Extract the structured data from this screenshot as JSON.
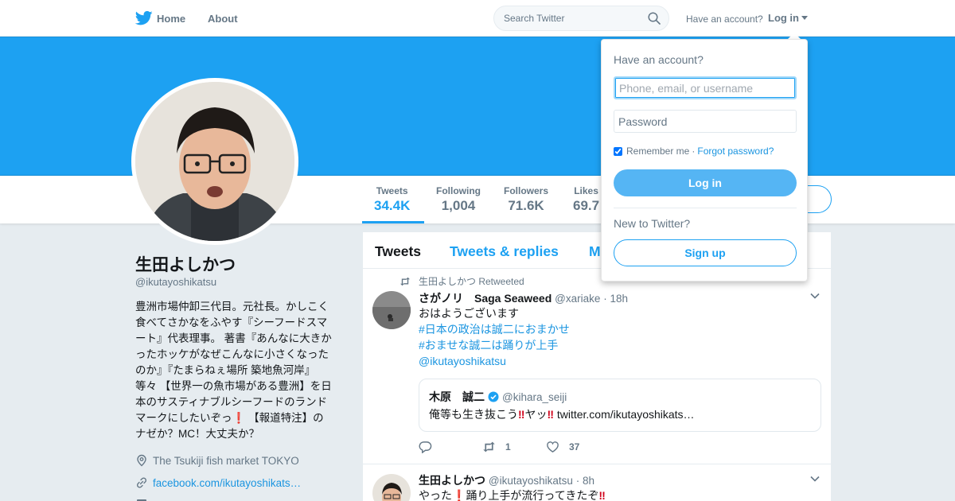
{
  "nav": {
    "home_label": "Home",
    "about_label": "About",
    "search_placeholder": "Search Twitter",
    "have_account": "Have an account?",
    "login_label": "Log in",
    "brand_color": "#1da1f2"
  },
  "profile": {
    "name": "生田よしかつ",
    "handle": "@ikutayoshikatsu",
    "bio_lines": [
      "豊洲市場仲卸三代目。元社長。かしこく",
      "食べてさかなをふやす『シーフードスマ",
      "ート』代表理事。 著書『あんなに大きか",
      "ったホッケがなぜこんなに小さくなった",
      "のか』『たまらねぇ場所 築地魚河岸』",
      "等々 【世界一の魚市場がある豊洲】を日",
      "本のサスティナブルシーフードのランド",
      "マークにしたいぞっ",
      "❗",
      " 【報道特注】の",
      "ナゼか？MC！大丈夫か？"
    ],
    "location": "The Tsukiji fish market TOKYO",
    "website": "facebook.com/ikutayoshikats…"
  },
  "stats": [
    {
      "label": "Tweets",
      "value": "34.4K"
    },
    {
      "label": "Following",
      "value": "1,004"
    },
    {
      "label": "Followers",
      "value": "71.6K"
    },
    {
      "label": "Likes",
      "value": "69.7"
    }
  ],
  "timeline": {
    "tabs": [
      "Tweets",
      "Tweets & replies",
      "M"
    ],
    "tweets": [
      {
        "retweet_text": "生田よしかつ Retweeted",
        "fullname": "さがノリ　Saga Seaweed",
        "screen_name": "@xariake",
        "time": "· 18h",
        "text": "おはようございます",
        "hashtags": [
          "#日本の政治は誠二におまかせ",
          "#おませな誠二は踊りが上手"
        ],
        "mention": "@ikutayoshikatsu",
        "quote": {
          "fullname": "木原　誠二",
          "screen_name": "@kihara_seiji",
          "text_before": "俺等も生き抜こう",
          "text_mid": "ヤッ",
          "link": "twitter.com/ikutayoshikats…",
          "emoji": "‼"
        },
        "retweets": "1",
        "likes": "37"
      },
      {
        "fullname": "生田よしかつ",
        "screen_name": "@ikutayoshikatsu",
        "time": "· 8h",
        "text_before": "やった",
        "text_after": "踊り上手が流行ってきたぞ",
        "emoji_red": "❗",
        "emoji_double": "‼"
      }
    ]
  },
  "login_dropdown": {
    "title": "Have an account?",
    "username_placeholder": "Phone, email, or username",
    "password_placeholder": "Password",
    "remember_me": "Remember me",
    "separator": "·",
    "forgot_password": "Forgot password?",
    "login_button": "Log in",
    "new_to_twitter": "New to Twitter?",
    "signup_button": "Sign up"
  }
}
